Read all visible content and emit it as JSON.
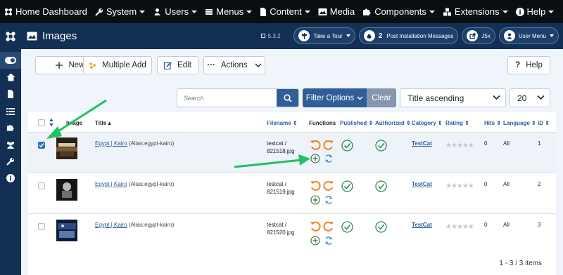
{
  "topmenu": [
    {
      "label": "Home Dashboard",
      "icon": "joomla-icon"
    },
    {
      "label": "System",
      "icon": "wrench-icon"
    },
    {
      "label": "Users",
      "icon": "users-icon"
    },
    {
      "label": "Menus",
      "icon": "menu-list-icon"
    },
    {
      "label": "Content",
      "icon": "file-icon"
    },
    {
      "label": "Media",
      "icon": "image-icon"
    },
    {
      "label": "Components",
      "icon": "puzzle-icon"
    },
    {
      "label": "Extensions",
      "icon": "cubes-icon"
    },
    {
      "label": "Help",
      "icon": "info-icon"
    }
  ],
  "header": {
    "title": "Images",
    "version": "5.3.2",
    "take_tour": "Take a Tour",
    "post_install_count": "2",
    "post_install": "Post Installation Messages",
    "j5x": "J5x",
    "user_menu": "User Menu"
  },
  "toolbar": {
    "new": "New",
    "multiple_add": "Multiple Add",
    "edit": "Edit",
    "actions": "Actions",
    "help": "Help"
  },
  "filters": {
    "search_placeholder": "Search",
    "filter_options": "Filter Options",
    "clear": "Clear",
    "ordering": "Title ascending",
    "limit": "20"
  },
  "columns": {
    "image": "Image",
    "title": "Title",
    "filename": "Filename",
    "functions": "Functions",
    "published": "Published",
    "authorized": "Authorized",
    "category": "Category",
    "rating": "Rating",
    "hits": "Hits",
    "language": "Language",
    "id": "ID"
  },
  "rows": [
    {
      "title": "Egypt | Kairo",
      "alias": "(Alias:egypt-kairo)",
      "file1": "testcat /",
      "file2": "821518.jpg",
      "category": "TestCat",
      "hits": "0",
      "language": "All",
      "id": "1",
      "checked": true
    },
    {
      "title": "Egypt | Kairo",
      "alias": "(Alias:egypt-kairo)",
      "file1": "testcat /",
      "file2": "821519.jpg",
      "category": "TestCat",
      "hits": "0",
      "language": "All",
      "id": "2",
      "checked": false
    },
    {
      "title": "Egypt | Kairo",
      "alias": "(Alias:egypt-kairo)",
      "file1": "testcat /",
      "file2": "821520.jpg",
      "category": "TestCat",
      "hits": "0",
      "language": "All",
      "id": "3",
      "checked": false
    }
  ],
  "pagination": "1 - 3 / 3 items",
  "colors": {
    "topbar": "#0a0e11",
    "header": "#132f53",
    "primary": "#2f5e98",
    "success": "#2a8a50",
    "warning": "#f0831e",
    "arrow": "#21c064"
  }
}
